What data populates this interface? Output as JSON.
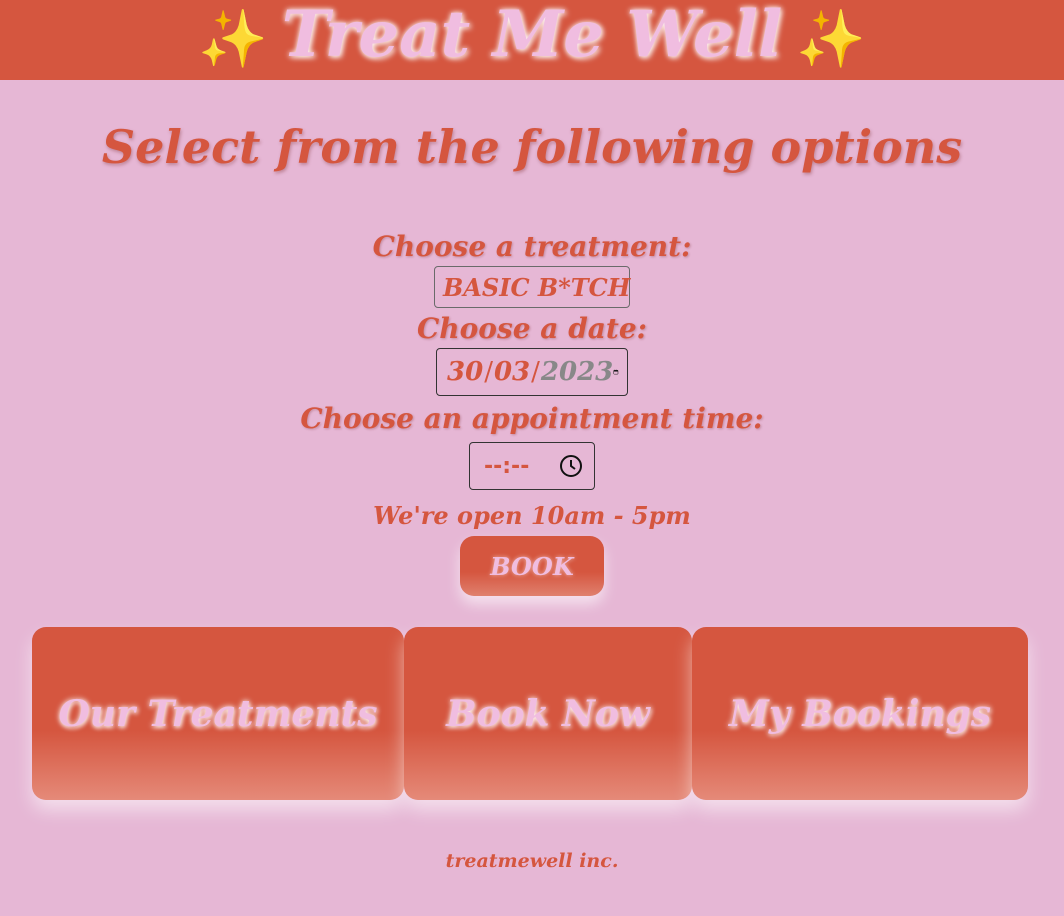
{
  "header": {
    "sparkle_left": "✨",
    "title": "Treat Me Well",
    "sparkle_right": "✨"
  },
  "main": {
    "heading": "Select from the following options",
    "treatment": {
      "label": "Choose a treatment:",
      "selected": "BASIC B*TCH"
    },
    "date": {
      "label": "Choose a date:",
      "day": "30",
      "month": "03",
      "year": "2023",
      "separator": "/"
    },
    "time": {
      "label": "Choose an appointment time:",
      "value": "--:--"
    },
    "hours_note": "We're open 10am - 5pm",
    "book_label": "BOOK"
  },
  "nav": {
    "cards": [
      {
        "label": "Our Treatments"
      },
      {
        "label": "Book Now"
      },
      {
        "label": "My Bookings"
      }
    ]
  },
  "footer": {
    "text": "treatmewell inc."
  },
  "colors": {
    "background": "#e6b7d5",
    "accent": "#d5563f",
    "accent_text": "#f0bde0",
    "sparkle": "#f7d33c"
  }
}
